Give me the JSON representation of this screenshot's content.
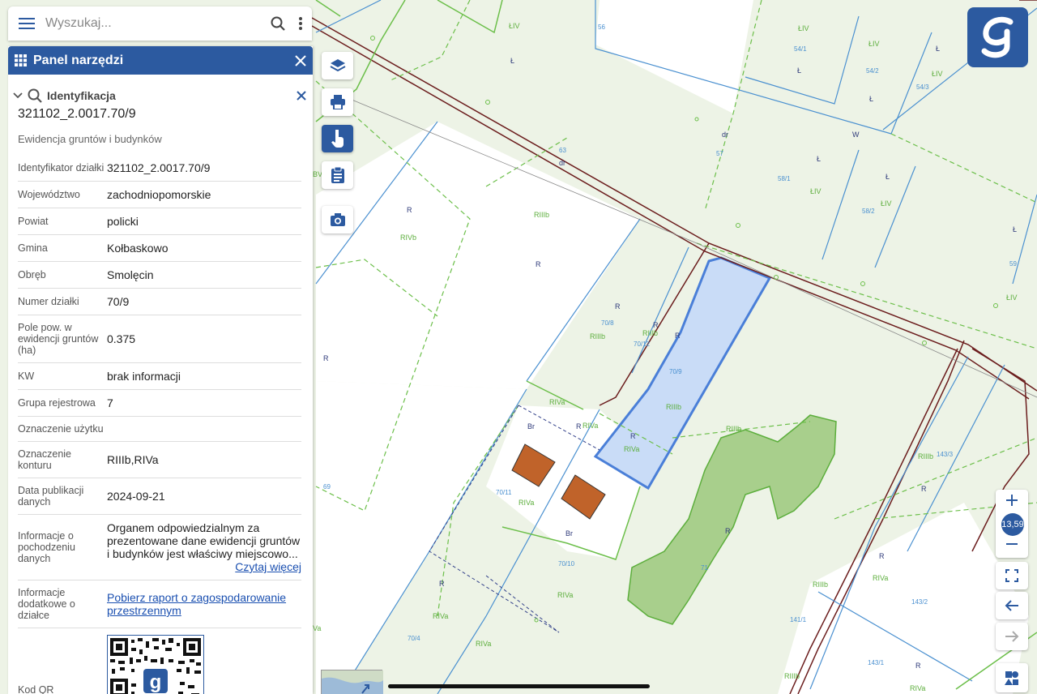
{
  "search": {
    "placeholder": "Wyszukaj..."
  },
  "panel": {
    "title": "Panel narzędzi"
  },
  "identification": {
    "title": "Identyfikacja",
    "parcel_id": "321102_2.0017.70/9",
    "subtitle": "Ewidencja gruntów i budynków",
    "rows": [
      {
        "key": "Identyfikator działki",
        "value": "321102_2.0017.70/9"
      },
      {
        "key": "Województwo",
        "value": "zachodniopomorskie"
      },
      {
        "key": "Powiat",
        "value": "policki"
      },
      {
        "key": "Gmina",
        "value": "Kołbaskowo"
      },
      {
        "key": "Obręb",
        "value": "Smolęcin"
      },
      {
        "key": "Numer działki",
        "value": "70/9"
      },
      {
        "key": "Pole pow. w ewidencji gruntów (ha)",
        "value": "0.375"
      },
      {
        "key": "KW",
        "value": "brak informacji"
      },
      {
        "key": "Grupa rejestrowa",
        "value": "7"
      },
      {
        "key": "Oznaczenie użytku",
        "value": ""
      },
      {
        "key": "Oznaczenie konturu",
        "value": "RIIIb,RIVa"
      },
      {
        "key": "Data publikacji danych",
        "value": "2024-09-21"
      },
      {
        "key": "Informacje o pochodzeniu danych",
        "value": "Organem odpowiedzialnym za prezentowane dane ewidencji gruntów i budynków jest właściwy miejscowo...",
        "link": "Czytaj więcej"
      },
      {
        "key": "Informacje dodatkowe o działce",
        "link": "Pobierz raport o zagospodarowanie przestrzennym"
      },
      {
        "key": "Kod QR"
      }
    ]
  },
  "map": {
    "zoom_level": "13,59",
    "labels": [
      {
        "t": "ŁIV",
        "c": "green"
      },
      {
        "t": "Ł",
        "c": "dark"
      },
      {
        "t": "ŁIV",
        "c": "green"
      },
      {
        "t": "54/1",
        "c": "blue"
      },
      {
        "t": "ŁIV",
        "c": "green"
      },
      {
        "t": "Ł",
        "c": "dark"
      },
      {
        "t": "Ł",
        "c": "dark"
      },
      {
        "t": "54/2",
        "c": "blue"
      },
      {
        "t": "ŁIV",
        "c": "green"
      },
      {
        "t": "54/3",
        "c": "blue"
      },
      {
        "t": "Ł",
        "c": "dark"
      },
      {
        "t": "Ł",
        "c": "dark"
      },
      {
        "t": "W",
        "c": "dark"
      },
      {
        "t": "dr",
        "c": "dark"
      },
      {
        "t": "57",
        "c": "blue"
      },
      {
        "t": "63",
        "c": "blue"
      },
      {
        "t": "dr",
        "c": "dark"
      },
      {
        "t": "Ł",
        "c": "dark"
      },
      {
        "t": "58/1",
        "c": "blue"
      },
      {
        "t": "ŁIV",
        "c": "green"
      },
      {
        "t": "Ł",
        "c": "dark"
      },
      {
        "t": "ŁIV",
        "c": "green"
      },
      {
        "t": "58/2",
        "c": "blue"
      },
      {
        "t": "Ł",
        "c": "dark"
      },
      {
        "t": "59",
        "c": "blue"
      },
      {
        "t": "ŁIV",
        "c": "green"
      },
      {
        "t": "R",
        "c": "dark"
      },
      {
        "t": "RIVb",
        "c": "green"
      },
      {
        "t": "RIIIb",
        "c": "green"
      },
      {
        "t": "R",
        "c": "dark"
      },
      {
        "t": "R",
        "c": "dark"
      },
      {
        "t": "70/8",
        "c": "blue"
      },
      {
        "t": "RIIIb",
        "c": "green"
      },
      {
        "t": "R",
        "c": "dark"
      },
      {
        "t": "RIIIb",
        "c": "green"
      },
      {
        "t": "70/12",
        "c": "blue"
      },
      {
        "t": "R",
        "c": "dark"
      },
      {
        "t": "70/9",
        "c": "blue"
      },
      {
        "t": "RIIIb",
        "c": "green"
      },
      {
        "t": "R",
        "c": "dark"
      },
      {
        "t": "RIVa",
        "c": "green"
      },
      {
        "t": "Br",
        "c": "dark"
      },
      {
        "t": "R",
        "c": "dark"
      },
      {
        "t": "RIVa",
        "c": "green"
      },
      {
        "t": "R",
        "c": "dark"
      },
      {
        "t": "RIVa",
        "c": "green"
      },
      {
        "t": "RIIIb",
        "c": "green"
      },
      {
        "t": "70/11",
        "c": "blue"
      },
      {
        "t": "RIVa",
        "c": "green"
      },
      {
        "t": "Br",
        "c": "dark"
      },
      {
        "t": "70/10",
        "c": "blue"
      },
      {
        "t": "R",
        "c": "dark"
      },
      {
        "t": "RIVa",
        "c": "green"
      },
      {
        "t": "R",
        "c": "dark"
      },
      {
        "t": "RIVa",
        "c": "green"
      },
      {
        "t": "70/4",
        "c": "blue"
      },
      {
        "t": "RIVa",
        "c": "green"
      },
      {
        "t": "69",
        "c": "blue"
      },
      {
        "t": "R",
        "c": "dark"
      },
      {
        "t": "71",
        "c": "blue"
      },
      {
        "t": "RIIIb",
        "c": "green"
      },
      {
        "t": "143/3",
        "c": "blue"
      },
      {
        "t": "R",
        "c": "dark"
      },
      {
        "t": "R",
        "c": "dark"
      },
      {
        "t": "RIIIb",
        "c": "green"
      },
      {
        "t": "RIVa",
        "c": "green"
      },
      {
        "t": "143/2",
        "c": "blue"
      },
      {
        "t": "141/1",
        "c": "blue"
      },
      {
        "t": "143/1",
        "c": "blue"
      },
      {
        "t": "R",
        "c": "dark"
      },
      {
        "t": "RIIIb",
        "c": "green"
      },
      {
        "t": "RIVa",
        "c": "green"
      },
      {
        "t": "R",
        "c": "dark"
      },
      {
        "t": "BV",
        "c": "green"
      },
      {
        "t": "56",
        "c": "blue"
      },
      {
        "t": "Va",
        "c": "green"
      }
    ]
  },
  "colors": {
    "primary": "#2c5aa0",
    "parcel_border": "#4a7fd8",
    "building": "#c0632a",
    "road_border": "#6b1d1d",
    "contour_green": "#6cbf4a"
  }
}
